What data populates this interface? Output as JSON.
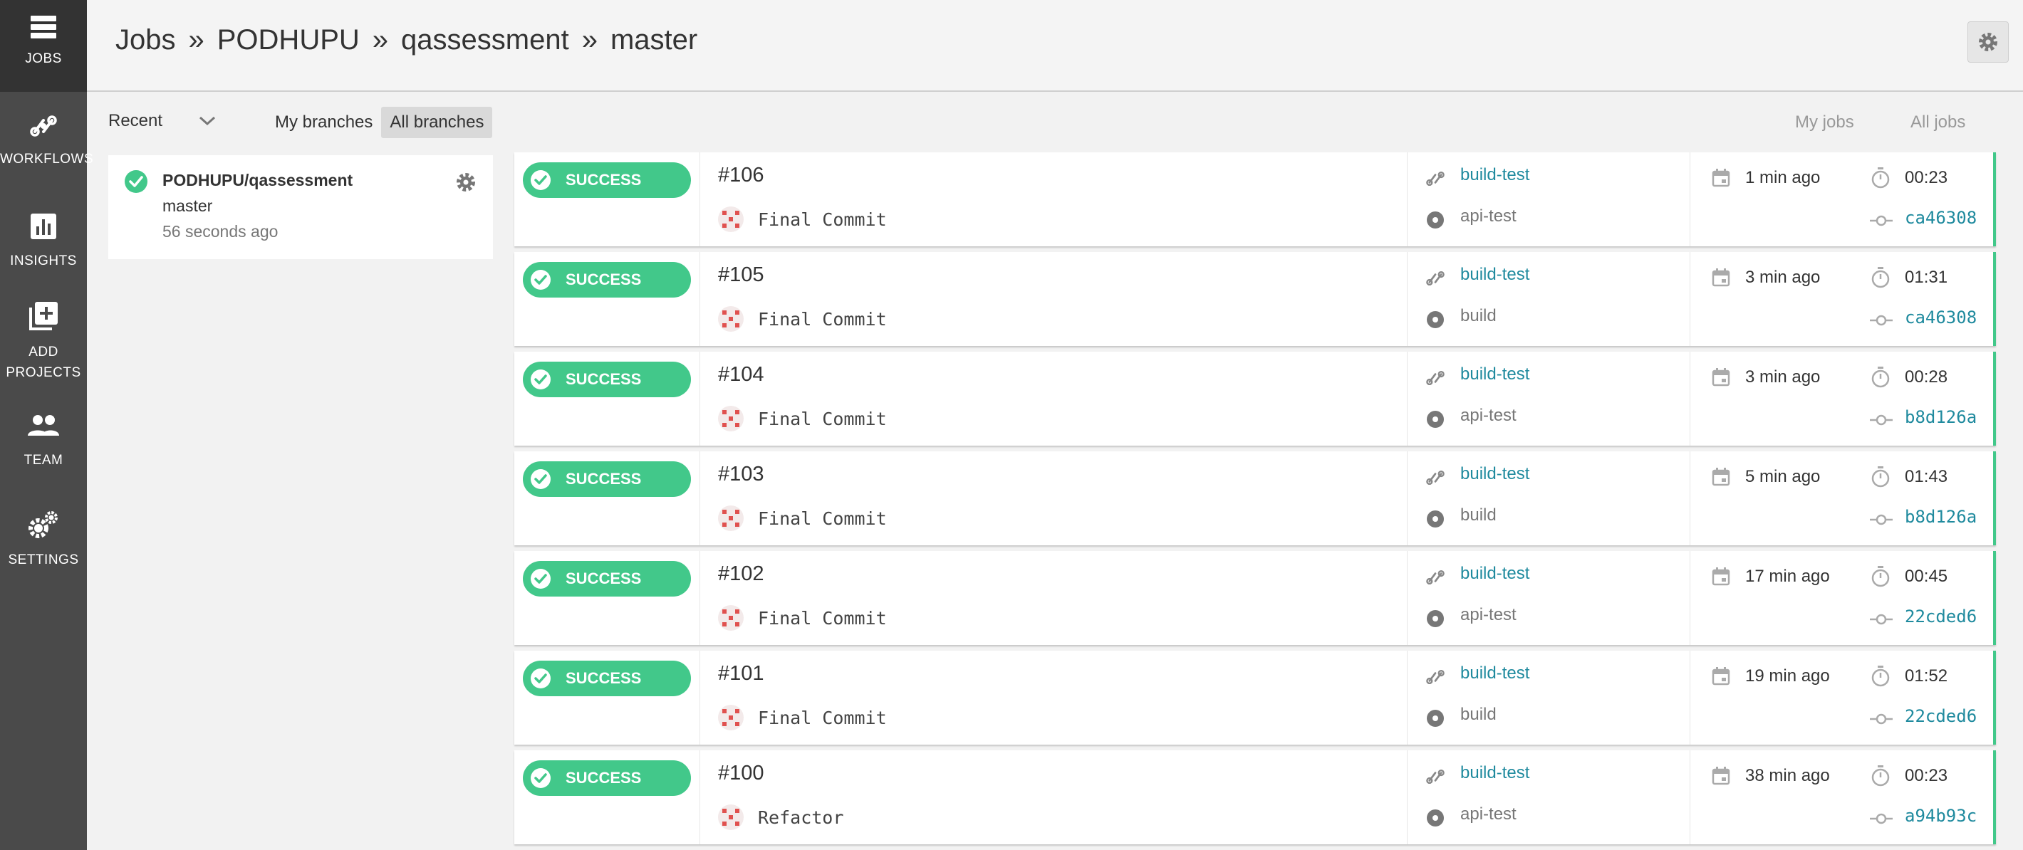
{
  "sidebar": {
    "items": [
      {
        "label": "JOBS",
        "icon": "jobs-icon",
        "active": true
      },
      {
        "label": "WORKFLOWS",
        "icon": "workflows-icon"
      },
      {
        "label": "INSIGHTS",
        "icon": "insights-icon"
      },
      {
        "label": "ADD",
        "label2": "PROJECTS",
        "icon": "add-projects-icon"
      },
      {
        "label": "TEAM",
        "icon": "team-icon"
      },
      {
        "label": "SETTINGS",
        "icon": "settings-icon"
      }
    ]
  },
  "header": {
    "crumbs": [
      "Jobs",
      "PODHUPU",
      "qassessment",
      "master"
    ],
    "separator": "»"
  },
  "filters": {
    "recent": "Recent",
    "my_branches": "My branches",
    "all_branches": "All branches",
    "my_jobs": "My jobs",
    "all_jobs": "All jobs"
  },
  "project": {
    "name": "PODHUPU/qassessment",
    "branch": "master",
    "time": "56 seconds ago"
  },
  "colors": {
    "success": "#42c88a",
    "link": "#1f8a9e",
    "sidebar": "#4a4a4a"
  },
  "jobs": [
    {
      "status": "SUCCESS",
      "number": "#106",
      "message": "Final Commit",
      "workflow": "build-test",
      "job": "api-test",
      "ago": "1 min ago",
      "duration": "00:23",
      "sha": "ca46308"
    },
    {
      "status": "SUCCESS",
      "number": "#105",
      "message": "Final Commit",
      "workflow": "build-test",
      "job": "build",
      "ago": "3 min ago",
      "duration": "01:31",
      "sha": "ca46308"
    },
    {
      "status": "SUCCESS",
      "number": "#104",
      "message": "Final Commit",
      "workflow": "build-test",
      "job": "api-test",
      "ago": "3 min ago",
      "duration": "00:28",
      "sha": "b8d126a"
    },
    {
      "status": "SUCCESS",
      "number": "#103",
      "message": "Final Commit",
      "workflow": "build-test",
      "job": "build",
      "ago": "5 min ago",
      "duration": "01:43",
      "sha": "b8d126a"
    },
    {
      "status": "SUCCESS",
      "number": "#102",
      "message": "Final Commit",
      "workflow": "build-test",
      "job": "api-test",
      "ago": "17 min ago",
      "duration": "00:45",
      "sha": "22cded6"
    },
    {
      "status": "SUCCESS",
      "number": "#101",
      "message": "Final Commit",
      "workflow": "build-test",
      "job": "build",
      "ago": "19 min ago",
      "duration": "01:52",
      "sha": "22cded6"
    },
    {
      "status": "SUCCESS",
      "number": "#100",
      "message": "Refactor",
      "workflow": "build-test",
      "job": "api-test",
      "ago": "38 min ago",
      "duration": "00:23",
      "sha": "a94b93c"
    }
  ]
}
